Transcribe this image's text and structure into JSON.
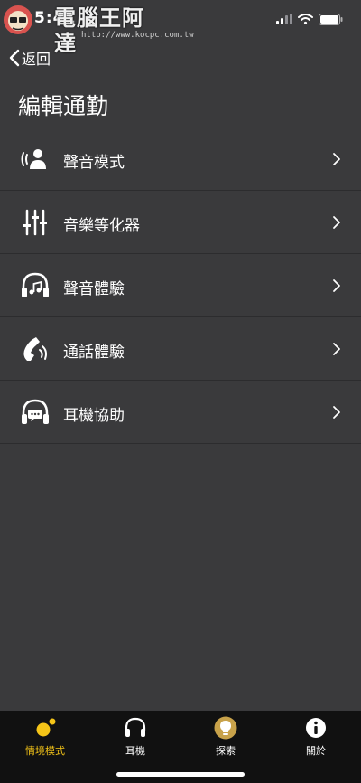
{
  "status_bar": {
    "time": "5:41"
  },
  "watermark": {
    "main": "電腦王阿達",
    "sub": "http://www.kocpc.com.tw"
  },
  "nav": {
    "back_label": "返回"
  },
  "page": {
    "title": "編輯通勤"
  },
  "menu": {
    "items": [
      {
        "label": "聲音模式",
        "icon": "voice-person-icon"
      },
      {
        "label": "音樂等化器",
        "icon": "equalizer-icon"
      },
      {
        "label": "聲音體驗",
        "icon": "headphones-music-icon"
      },
      {
        "label": "通話體驗",
        "icon": "phone-sound-icon"
      },
      {
        "label": "耳機協助",
        "icon": "headphones-chat-icon"
      }
    ]
  },
  "tabbar": {
    "items": [
      {
        "label": "情境模式",
        "icon": "scene-dots-icon",
        "active": true
      },
      {
        "label": "耳機",
        "icon": "headphones-icon",
        "active": false
      },
      {
        "label": "探索",
        "icon": "lightbulb-icon",
        "active": false
      },
      {
        "label": "關於",
        "icon": "info-icon",
        "active": false
      }
    ]
  },
  "colors": {
    "background": "#3a3a3c",
    "accent": "#f5c518",
    "tabbar": "#111111",
    "divider": "#2c2c2e"
  }
}
